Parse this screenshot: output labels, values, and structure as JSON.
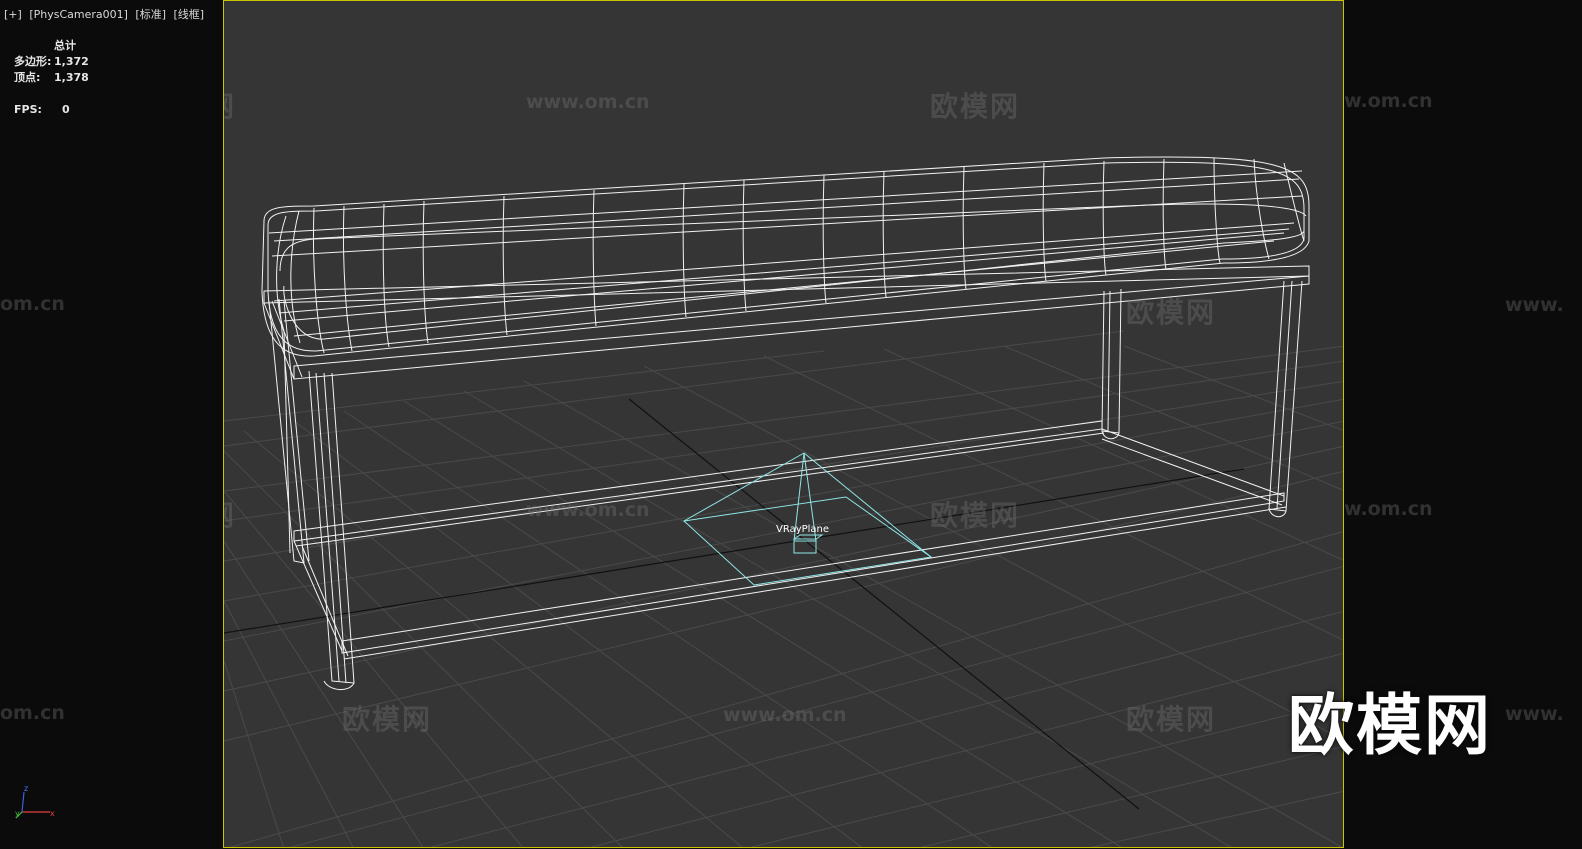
{
  "viewport": {
    "label_plus": "[+]",
    "label_camera": "[PhysCamera001]",
    "label_shading": "[标准]",
    "label_mode": "[线框]"
  },
  "stats": {
    "total_label": "总计",
    "polygons_label": "多边形:",
    "polygons_value": "1,372",
    "vertices_label": "顶点:",
    "vertices_value": "1,378",
    "fps_label": "FPS:",
    "fps_value": "0"
  },
  "scene": {
    "object_label": "VRayPlane"
  },
  "watermarks": {
    "cn": "欧模网",
    "url": "www.om.cn",
    "url_partial": "om.cn",
    "url_prefix": "www.",
    "logo": "欧模网"
  },
  "axis": {
    "x": "x",
    "y": "y",
    "z": "z"
  },
  "colors": {
    "viewport_bg": "#353535",
    "outside_bg": "#0b0b0b",
    "safe_frame": "#c9c400",
    "wire": "#ffffff",
    "vray_plane": "#8fe6e6",
    "grid": "#484848"
  }
}
